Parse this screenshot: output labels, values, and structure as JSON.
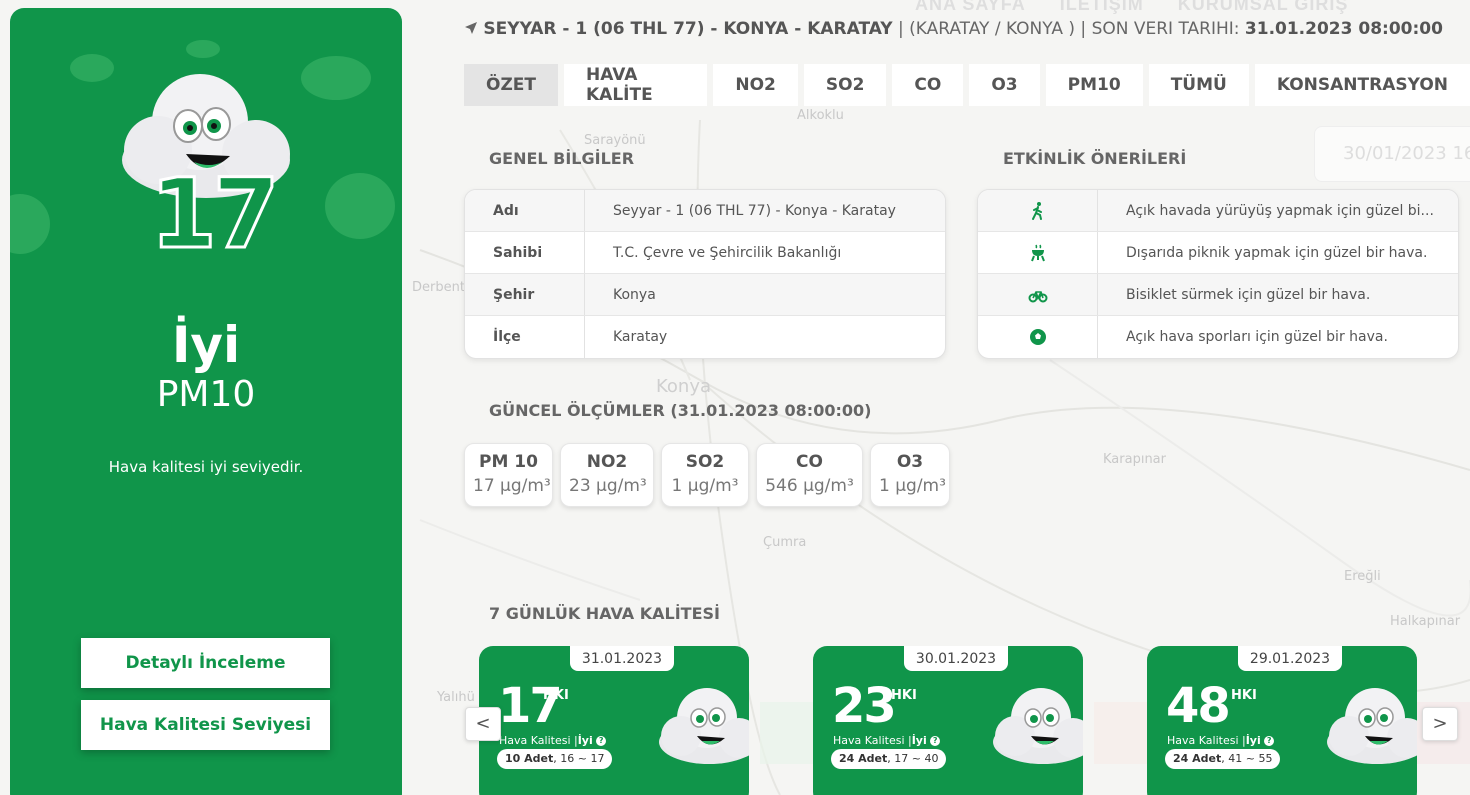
{
  "top_nav": {
    "home": "ANA SAYFA",
    "contact": "İLETİŞİM",
    "corporate_login": "KURUMSAL GİRİŞ"
  },
  "map_labels": {
    "a": "Alkoklu",
    "b": "Sarayönü",
    "c": "Derbent",
    "d": "Konya",
    "e": "Karapınar",
    "f": "Çumra",
    "g": "Ereğli",
    "h": "Halkapınar",
    "i": "Yalıhü"
  },
  "left_panel": {
    "aqi_value": "17",
    "level": "İyi",
    "pollutant": "PM10",
    "description": "Hava kalitesi iyi seviyedir.",
    "detail_button": "Detaylı İnceleme",
    "level_button": "Hava Kalitesi Seviyesi",
    "accent_color": "#10954a"
  },
  "station_header": {
    "icon": "location-arrow-icon",
    "name": "SEYYAR - 1 (06 THL 77) - KONYA - KARATAY",
    "separator1": "|",
    "location": "(KARATAY / KONYA )",
    "separator2": "|",
    "last_data_label": "SON VERI TARIHI:",
    "last_data_value": "31.01.2023 08:00:00"
  },
  "tabs": [
    "ÖZET",
    "HAVA KALİTE",
    "NO2",
    "SO2",
    "CO",
    "O3",
    "PM10",
    "TÜMÜ",
    "KONSANTRASYON"
  ],
  "date_input": {
    "value": "30/01/2023 16"
  },
  "general_info": {
    "title": "GENEL BİLGİLER",
    "rows": [
      {
        "key": "Adı",
        "value": "Seyyar - 1 (06 THL 77) - Konya - Karatay"
      },
      {
        "key": "Sahibi",
        "value": "T.C. Çevre ve Şehircilik Bakanlığı"
      },
      {
        "key": "Şehir",
        "value": "Konya"
      },
      {
        "key": "İlçe",
        "value": "Karatay"
      }
    ]
  },
  "activities": {
    "title": "ETKİNLİK ÖNERİLERİ",
    "rows": [
      {
        "icon": "walking-icon",
        "text": "Açık havada yürüyüş yapmak için güzel bi..."
      },
      {
        "icon": "grill-icon",
        "text": "Dışarıda piknik yapmak için güzel bir hava."
      },
      {
        "icon": "bicycle-icon",
        "text": "Bisiklet sürmek için güzel bir hava."
      },
      {
        "icon": "soccer-ball-icon",
        "text": "Açık hava sporları için güzel bir hava."
      }
    ]
  },
  "current_measurements": {
    "title": "GÜNCEL ÖLÇÜMLER (31.01.2023 08:00:00)",
    "items": [
      {
        "name": "PM 10",
        "value": "17 µg/m³"
      },
      {
        "name": "NO2",
        "value": "23 µg/m³"
      },
      {
        "name": "SO2",
        "value": "1 µg/m³"
      },
      {
        "name": "CO",
        "value": "546 µg/m³"
      },
      {
        "name": "O3",
        "value": "1 µg/m³"
      }
    ]
  },
  "seven_day": {
    "title": "7 GÜNLÜK HAVA KALİTESİ",
    "prev": "<",
    "next": ">",
    "cards": [
      {
        "date": "31.01.2023",
        "value": "17",
        "unit": "HKI",
        "quality_label": "Hava Kalitesi |",
        "quality": "İyi",
        "count": "10 Adet",
        "range": ", 16 ~ 17"
      },
      {
        "date": "30.01.2023",
        "value": "23",
        "unit": "HKI",
        "quality_label": "Hava Kalitesi |",
        "quality": "İyi",
        "count": "24 Adet",
        "range": ", 17 ~ 40"
      },
      {
        "date": "29.01.2023",
        "value": "48",
        "unit": "HKI",
        "quality_label": "Hava Kalitesi |",
        "quality": "İyi",
        "count": "24 Adet",
        "range": ", 41 ~ 55"
      }
    ]
  }
}
